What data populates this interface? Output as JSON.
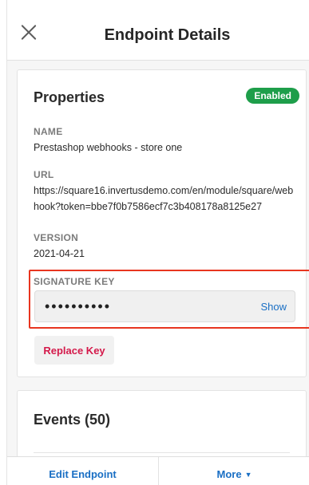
{
  "header": {
    "title": "Endpoint Details"
  },
  "properties": {
    "title": "Properties",
    "status_badge": "Enabled",
    "name_label": "NAME",
    "name_value": "Prestashop webhooks - store one",
    "url_label": "URL",
    "url_value": "https://square16.invertusdemo.com/en/module/square/webhook?token=bbe7f0b7586ecf7c3b408178a8125e27",
    "version_label": "VERSION",
    "version_value": "2021-04-21",
    "signature_label": "SIGNATURE KEY",
    "signature_masked": "••••••••••",
    "show_label": "Show",
    "replace_label": "Replace Key"
  },
  "events": {
    "title": "Events (50)"
  },
  "footer": {
    "edit_label": "Edit Endpoint",
    "more_label": "More"
  },
  "colors": {
    "badge": "#1e9e4a",
    "link": "#1a6fc4",
    "replace": "#d4194a",
    "highlight": "#e8351f"
  }
}
